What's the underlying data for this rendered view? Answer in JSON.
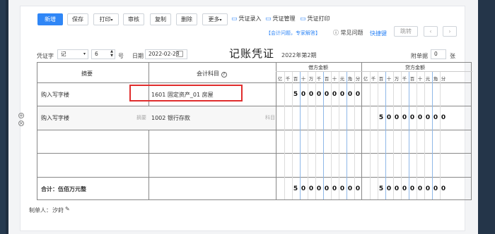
{
  "toolbar": {
    "new_label": "新增",
    "save_label": "保存",
    "print_label": "打印",
    "audit_label": "审核",
    "copy_label": "复制",
    "delete_label": "删除",
    "more_label": "更多",
    "voucher_entry": "凭证录入",
    "voucher_manage": "凭证管理",
    "voucher_print": "凭证打印"
  },
  "help": {
    "consult": "【会计问题，专家解答】",
    "faq": "常见问题",
    "shortcut": "快捷键",
    "jump": "跳转"
  },
  "voucher": {
    "word_label": "凭证字",
    "word_value": "记",
    "number_value": "6",
    "number_unit": "号",
    "date_label": "日期",
    "date_value": "2022-02-28",
    "title": "记账凭证",
    "period": "2022年第2期",
    "attachment_label": "附单据",
    "attachment_value": "0",
    "attachment_unit": "张"
  },
  "table": {
    "summary_header": "摘要",
    "account_header": "会计科目",
    "debit_header": "借方金额",
    "credit_header": "贷方金额",
    "units": [
      "亿",
      "千",
      "百",
      "十",
      "万",
      "千",
      "百",
      "十",
      "元",
      "角",
      "分"
    ],
    "rows": [
      {
        "summary": "购入写字楼",
        "account": "1601 固定资产_01 房屋",
        "debit": [
          "",
          "",
          "5",
          "0",
          "0",
          "0",
          "0",
          "0",
          "0",
          "0",
          "0"
        ],
        "credit": [
          "",
          "",
          "",
          "",
          "",
          "",
          "",
          "",
          "",
          "",
          ""
        ]
      },
      {
        "summary": "购入写字楼",
        "account": "1002 银行存款",
        "summary_hint": "摘要",
        "account_hint": "科目",
        "debit": [
          "",
          "",
          "",
          "",
          "",
          "",
          "",
          "",
          "",
          "",
          ""
        ],
        "credit": [
          "",
          "",
          "5",
          "0",
          "0",
          "0",
          "0",
          "0",
          "0",
          "0",
          "0"
        ]
      },
      {
        "summary": "",
        "account": "",
        "debit": [],
        "credit": []
      },
      {
        "summary": "",
        "account": "",
        "debit": [],
        "credit": []
      }
    ],
    "total_label": "合计：伍佰万元整",
    "total_debit": [
      "",
      "",
      "5",
      "0",
      "0",
      "0",
      "0",
      "0",
      "0",
      "0",
      "0"
    ],
    "total_credit": [
      "",
      "",
      "5",
      "0",
      "0",
      "0",
      "0",
      "0",
      "0",
      "0",
      "0"
    ]
  },
  "footer": {
    "maker_label": "制单人：",
    "maker_name": "汐莳"
  }
}
